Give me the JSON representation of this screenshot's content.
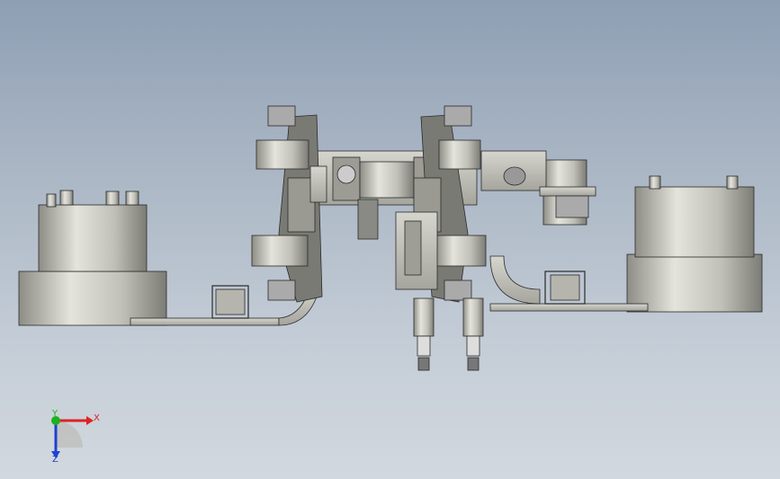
{
  "viewport": {
    "background_top": "#8e9fb4",
    "background_bottom": "#d2d8de"
  },
  "triad": {
    "x_label": "X",
    "y_label": "Y",
    "z_label": "Z",
    "x_color": "#e02020",
    "y_color": "#20b020",
    "z_color": "#2040d0"
  },
  "model": {
    "part_color": "#c8c8bc",
    "dark_color": "#6a6a64",
    "edge_color": "#2a2a2a"
  }
}
